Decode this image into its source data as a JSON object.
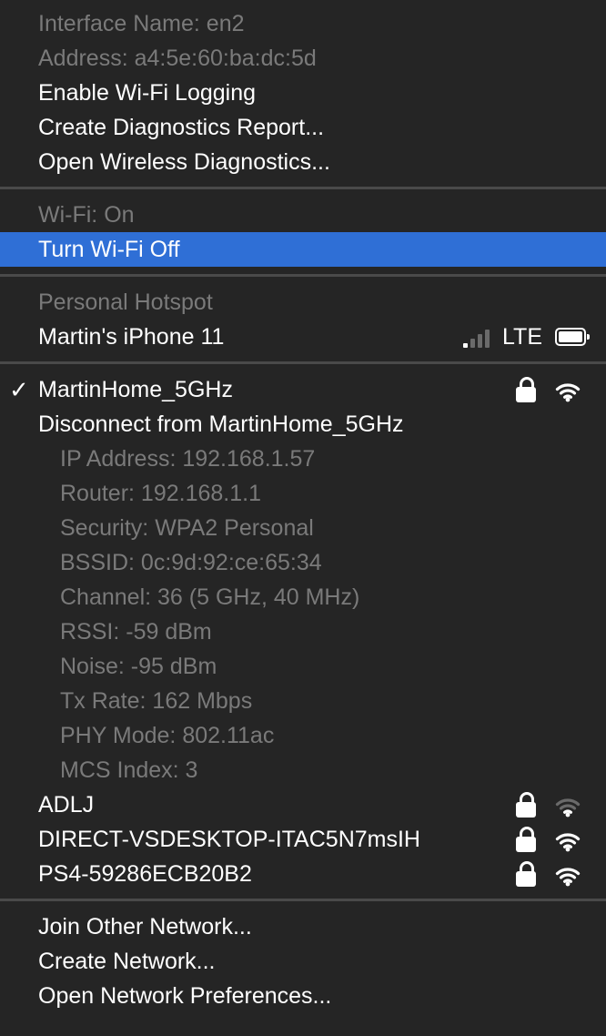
{
  "interface": {
    "name": "Interface Name: en2",
    "address": "Address: a4:5e:60:ba:dc:5d",
    "enable_logging": "Enable Wi-Fi Logging",
    "create_report": "Create Diagnostics Report...",
    "open_diagnostics": "Open Wireless Diagnostics..."
  },
  "wifi": {
    "status": "Wi-Fi: On",
    "toggle": "Turn Wi-Fi Off"
  },
  "hotspot": {
    "header": "Personal Hotspot",
    "device": "Martin's iPhone 11",
    "network_type": "LTE",
    "signal_bars": 1,
    "signal_bars_total": 4,
    "battery_level": 1.0
  },
  "current_network": {
    "check": "✓",
    "name": "MartinHome_5GHz",
    "disconnect": "Disconnect from MartinHome_5GHz",
    "details": [
      "IP Address: 192.168.1.57",
      "Router: 192.168.1.1",
      "Security: WPA2 Personal",
      "BSSID: 0c:9d:92:ce:65:34",
      "Channel: 36 (5 GHz, 40 MHz)",
      "RSSI: -59 dBm",
      "Noise: -95 dBm",
      "Tx Rate: 162 Mbps",
      "PHY Mode: 802.11ac",
      "MCS Index: 3"
    ]
  },
  "networks": [
    {
      "name": "ADLJ",
      "locked": true,
      "signal_arcs": 1
    },
    {
      "name": "DIRECT-VSDESKTOP-ITAC5N7msIH",
      "locked": true,
      "signal_arcs": 3
    },
    {
      "name": "PS4-59286ECB20B2",
      "locked": true,
      "signal_arcs": 3
    }
  ],
  "footer": {
    "join_other": "Join Other Network...",
    "create_network": "Create Network...",
    "open_prefs": "Open Network Preferences..."
  },
  "colors": {
    "background": "#252525",
    "highlight": "#2f6fd6",
    "dim_text": "#7a7a7a",
    "separator": "#4a4a4a"
  }
}
